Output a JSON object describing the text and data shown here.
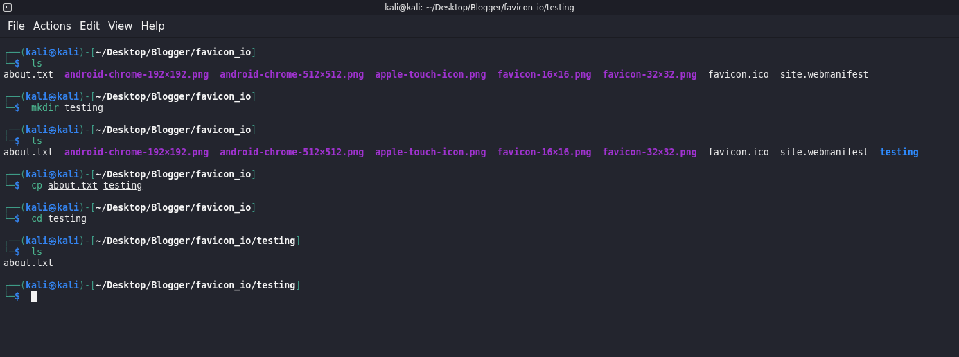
{
  "window": {
    "title": "kali@kali: ~/Desktop/Blogger/favicon_io/testing"
  },
  "menu": [
    "File",
    "Actions",
    "Edit",
    "View",
    "Help"
  ],
  "blocks": [
    {
      "prompt": {
        "open": "┌──(",
        "user": "kali",
        "mark": "㉿",
        "host": "kali",
        "mid": ")-[",
        "path": "~/Desktop/Blogger/favicon_io",
        "close": "]",
        "corner": "└─",
        "symbol": "$"
      },
      "command": [
        {
          "text": "ls",
          "kind": "cmd"
        }
      ],
      "output": [
        {
          "text": "about.txt",
          "kind": "file"
        },
        {
          "text": "android-chrome-192×192.png",
          "kind": "image"
        },
        {
          "text": "android-chrome-512×512.png",
          "kind": "image"
        },
        {
          "text": "apple-touch-icon.png",
          "kind": "image"
        },
        {
          "text": "favicon-16×16.png",
          "kind": "image"
        },
        {
          "text": "favicon-32×32.png",
          "kind": "image"
        },
        {
          "text": "favicon.ico",
          "kind": "file"
        },
        {
          "text": "site.webmanifest",
          "kind": "file"
        }
      ]
    },
    {
      "prompt": {
        "open": "┌──(",
        "user": "kali",
        "mark": "㉿",
        "host": "kali",
        "mid": ")-[",
        "path": "~/Desktop/Blogger/favicon_io",
        "close": "]",
        "corner": "└─",
        "symbol": "$"
      },
      "command": [
        {
          "text": "mkdir",
          "kind": "cmd"
        },
        {
          "text": "testing",
          "kind": "arg"
        }
      ]
    },
    {
      "prompt": {
        "open": "┌──(",
        "user": "kali",
        "mark": "㉿",
        "host": "kali",
        "mid": ")-[",
        "path": "~/Desktop/Blogger/favicon_io",
        "close": "]",
        "corner": "└─",
        "symbol": "$"
      },
      "command": [
        {
          "text": "ls",
          "kind": "cmd"
        }
      ],
      "output": [
        {
          "text": "about.txt",
          "kind": "file"
        },
        {
          "text": "android-chrome-192×192.png",
          "kind": "image"
        },
        {
          "text": "android-chrome-512×512.png",
          "kind": "image"
        },
        {
          "text": "apple-touch-icon.png",
          "kind": "image"
        },
        {
          "text": "favicon-16×16.png",
          "kind": "image"
        },
        {
          "text": "favicon-32×32.png",
          "kind": "image"
        },
        {
          "text": "favicon.ico",
          "kind": "file"
        },
        {
          "text": "site.webmanifest",
          "kind": "file"
        },
        {
          "text": "testing",
          "kind": "dir"
        }
      ]
    },
    {
      "prompt": {
        "open": "┌──(",
        "user": "kali",
        "mark": "㉿",
        "host": "kali",
        "mid": ")-[",
        "path": "~/Desktop/Blogger/favicon_io",
        "close": "]",
        "corner": "└─",
        "symbol": "$"
      },
      "command": [
        {
          "text": "cp",
          "kind": "cmd"
        },
        {
          "text": "about.txt",
          "kind": "path"
        },
        {
          "text": "testing",
          "kind": "path"
        }
      ]
    },
    {
      "prompt": {
        "open": "┌──(",
        "user": "kali",
        "mark": "㉿",
        "host": "kali",
        "mid": ")-[",
        "path": "~/Desktop/Blogger/favicon_io",
        "close": "]",
        "corner": "└─",
        "symbol": "$"
      },
      "command": [
        {
          "text": "cd",
          "kind": "cmd"
        },
        {
          "text": "testing",
          "kind": "path"
        }
      ]
    },
    {
      "prompt": {
        "open": "┌──(",
        "user": "kali",
        "mark": "㉿",
        "host": "kali",
        "mid": ")-[",
        "path": "~/Desktop/Blogger/favicon_io/testing",
        "close": "]",
        "corner": "└─",
        "symbol": "$"
      },
      "command": [
        {
          "text": "ls",
          "kind": "cmd"
        }
      ],
      "output": [
        {
          "text": "about.txt",
          "kind": "file"
        }
      ]
    },
    {
      "prompt": {
        "open": "┌──(",
        "user": "kali",
        "mark": "㉿",
        "host": "kali",
        "mid": ")-[",
        "path": "~/Desktop/Blogger/favicon_io/testing",
        "close": "]",
        "corner": "└─",
        "symbol": "$"
      },
      "cursor": true
    }
  ]
}
